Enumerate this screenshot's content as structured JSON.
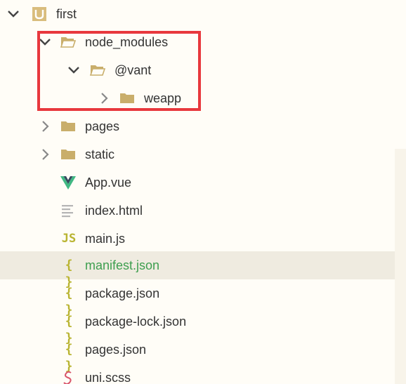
{
  "tree": {
    "items": [
      {
        "label": "first",
        "icon": "project-icon",
        "expanded": true
      },
      {
        "label": "node_modules",
        "icon": "folder-open-icon",
        "expanded": true
      },
      {
        "label": "@vant",
        "icon": "folder-open-icon",
        "expanded": true
      },
      {
        "label": "weapp",
        "icon": "folder-icon",
        "expanded": false
      },
      {
        "label": "pages",
        "icon": "folder-icon",
        "expanded": false
      },
      {
        "label": "static",
        "icon": "folder-icon",
        "expanded": false
      },
      {
        "label": "App.vue",
        "icon": "vue-icon"
      },
      {
        "label": "index.html",
        "icon": "html-file-icon"
      },
      {
        "label": "main.js",
        "icon": "js-file-icon",
        "icon_text": "JS"
      },
      {
        "label": "manifest.json",
        "icon": "json-file-icon",
        "icon_text": "{ }",
        "selected": true
      },
      {
        "label": "package.json",
        "icon": "json-file-icon",
        "icon_text": "{ }"
      },
      {
        "label": "package-lock.json",
        "icon": "json-file-icon",
        "icon_text": "{ }"
      },
      {
        "label": "pages.json",
        "icon": "json-file-icon",
        "icon_text": "{ }"
      },
      {
        "label": "uni.scss",
        "icon": "scss-file-icon"
      }
    ]
  },
  "colors": {
    "folder": "#c9ae6b",
    "vue": "#41b883",
    "js_json": "#b9b431",
    "selected_text": "#3e9f4f",
    "highlight": "#e8383d"
  }
}
